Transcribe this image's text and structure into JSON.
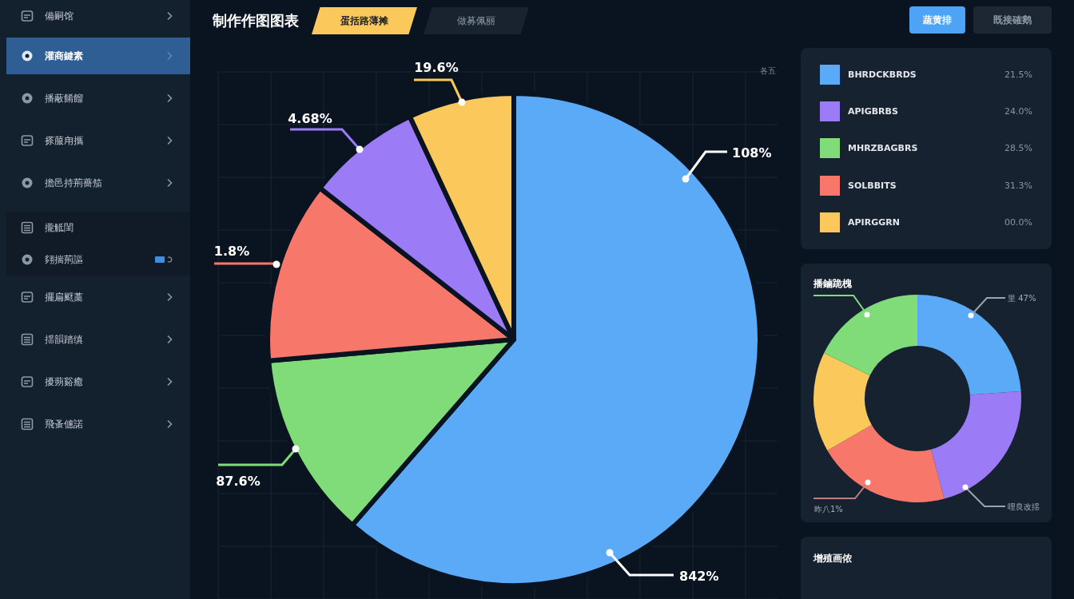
{
  "sidebar": {
    "sections": [
      {
        "kind": "plain",
        "items": [
          {
            "label": "備嗣馆",
            "kind": "chevron",
            "selected": false
          },
          {
            "label": "灌商鍵素",
            "kind": "chevron",
            "selected": true
          },
          {
            "label": "播蔽餚餾",
            "kind": "chevron",
            "selected": false
          },
          {
            "label": "搽菔甪攜",
            "kind": "chevron",
            "selected": false
          },
          {
            "label": "擔邑持荊薔笳",
            "kind": "chevron",
            "selected": false
          }
        ]
      },
      {
        "kind": "inset",
        "items": [
          {
            "label": "攏觝閨",
            "kind": "plain",
            "selected": false
          },
          {
            "label": "翗揣荊謳",
            "kind": "indicator",
            "selected": false
          }
        ]
      },
      {
        "kind": "plain",
        "items": [
          {
            "label": "擺扁颬藁",
            "kind": "chevron",
            "selected": false
          },
          {
            "label": "揺韻踏缜",
            "kind": "chevron",
            "selected": false
          },
          {
            "label": "擾蒴谿癒",
            "kind": "chevron",
            "selected": false
          },
          {
            "label": "飛蚤儢諾",
            "kind": "chevron",
            "selected": false
          }
        ]
      }
    ]
  },
  "header": {
    "title": "制作作图图表",
    "tabs": [
      {
        "label": "蛋括路薄摊",
        "selected": true
      },
      {
        "label": "做募佩丽",
        "selected": false
      }
    ]
  },
  "actions": [
    {
      "label": "蔬黄排",
      "kind": "primary"
    },
    {
      "label": "既接確鹅",
      "kind": "secondary"
    }
  ],
  "pie_chart": {
    "corner_label": "各五",
    "slices": [
      {
        "color": "#5aaaf8"
      },
      {
        "color": "#7fdc78"
      },
      {
        "color": "#f7776a"
      },
      {
        "color": "#9b7cf6"
      },
      {
        "color": "#fbc85c"
      }
    ],
    "callouts": [
      {
        "text": "19.6%",
        "color": "#fbc85c"
      },
      {
        "text": "4.68%",
        "color": "#9b7cf6"
      },
      {
        "text": "108%",
        "color": "#ffffff"
      },
      {
        "text": "1.8%",
        "color": "#f7776a"
      },
      {
        "text": "87.6%",
        "color": "#7fdc78"
      },
      {
        "text": "842%",
        "color": "#ffffff"
      }
    ]
  },
  "legend": {
    "items": [
      {
        "color": "#5aaaf8",
        "label": "BHRDCKBRDS",
        "value": "21.5%"
      },
      {
        "color": "#9b7cf6",
        "label": "APIGBRBS",
        "value": "24.0%"
      },
      {
        "color": "#7fdc78",
        "label": "MHRZBAGBRS",
        "value": "28.5%"
      },
      {
        "color": "#f7776a",
        "label": "SOLBBITS",
        "value": "31.3%"
      },
      {
        "color": "#fbc85c",
        "label": "APIRGGRN",
        "value": "00.0%"
      }
    ]
  },
  "donut_panel": {
    "title": "播鏀跪槐",
    "slices": [
      {
        "color": "#5aaaf8"
      },
      {
        "color": "#9b7cf6"
      },
      {
        "color": "#f7776a"
      },
      {
        "color": "#fbc85c"
      },
      {
        "color": "#7fdc78"
      }
    ],
    "callouts": [
      {
        "text": "里 47%",
        "color": "#9aa3ae"
      },
      {
        "color": "#7fdc78"
      },
      {
        "text": "昨八1%",
        "color": "#b88080"
      },
      {
        "text": "哩良改揺",
        "color": "#9aa3ae"
      }
    ]
  },
  "bottom_panel": {
    "title": "增殖画侬"
  }
}
